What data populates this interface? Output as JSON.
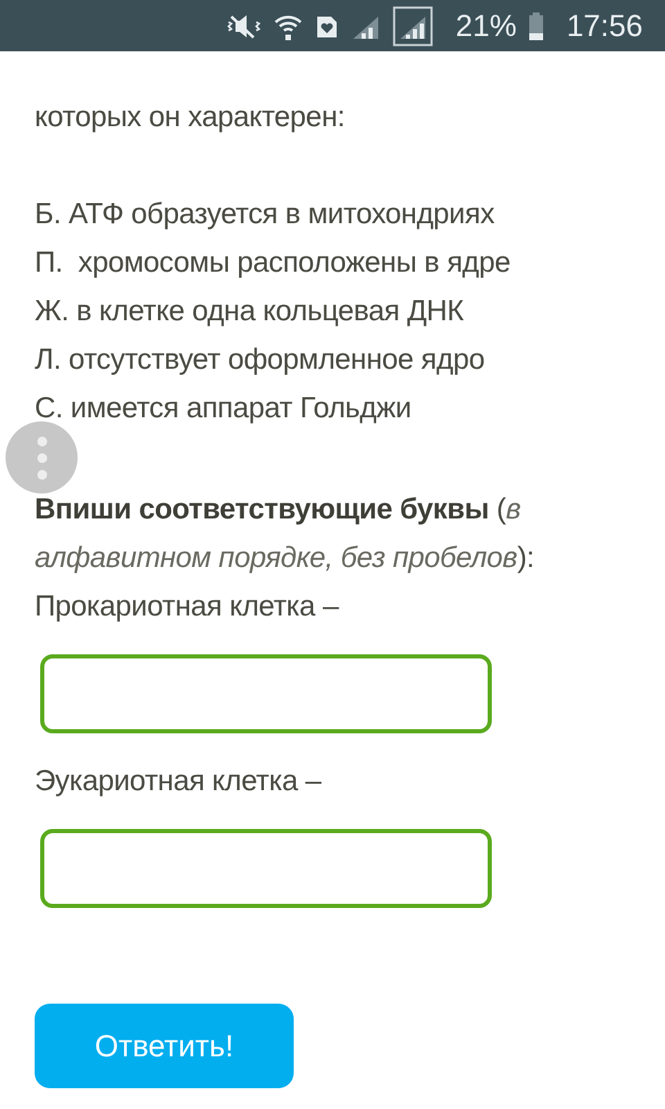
{
  "status_bar": {
    "battery": "21%",
    "time": "17:56"
  },
  "question": {
    "intro": "которых он характерен:",
    "options": [
      "Б. АТФ образуется в митохондриях",
      "П.  хромосомы расположены в ядре",
      "Ж. в клетке одна кольцевая ДНК",
      "Л. отсутствует оформленное ядро",
      "С. имеется аппарат Гольджи"
    ],
    "instruction": "**Впиши соответствующие буквы** (*в алфавитном порядке, без пробелов*):",
    "answers": [
      {
        "label": "Прокариотная клетка –"
      },
      {
        "label": "Эукариотная клетка –"
      }
    ]
  },
  "submit_button": "Ответить!"
}
